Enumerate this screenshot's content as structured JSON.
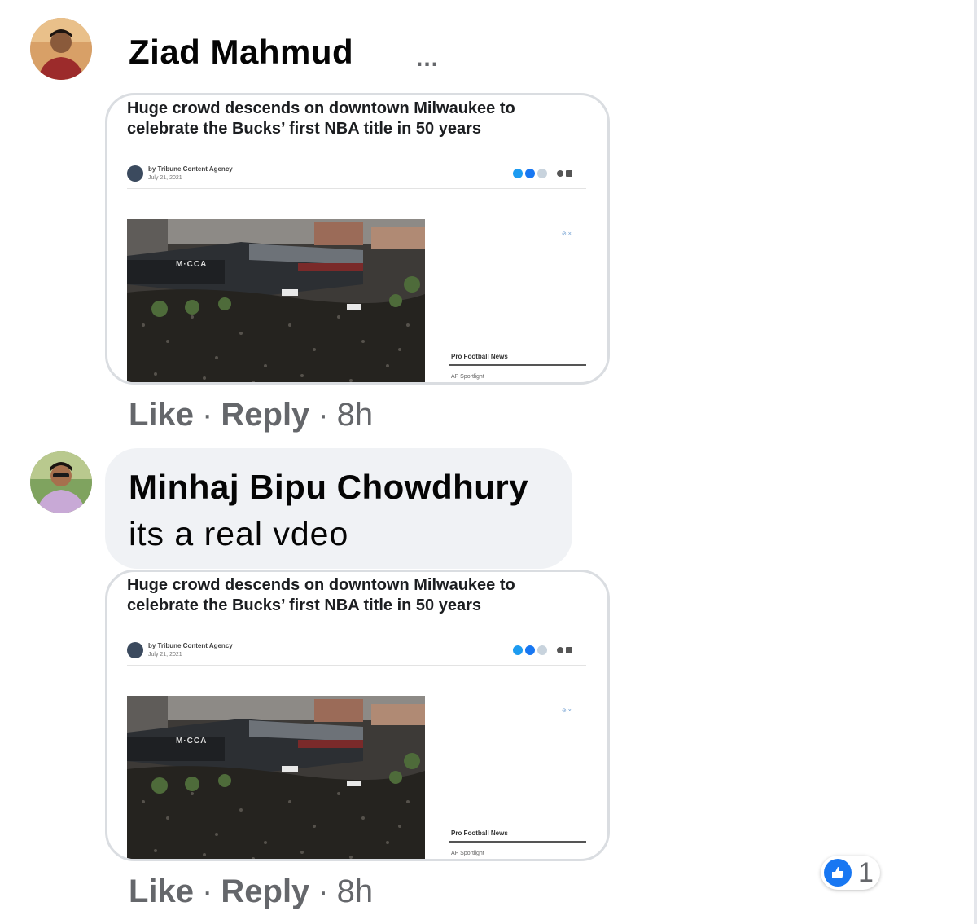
{
  "comments": [
    {
      "author": "Ziad Mahmud",
      "more_label": "...",
      "text": "",
      "link_card": {
        "headline": "Huge crowd descends on downtown Milwaukee to celebrate the Bucks’ first NBA title in 50 years",
        "byline": "by Tribune Content Agency",
        "date": "July 21, 2021",
        "ad_mark": "⊘ ×",
        "sidebar_link": "Pro Football News",
        "sidebar_sub": "AP Sportlight",
        "photo_sign": "M·CCA"
      },
      "actions": {
        "like": "Like",
        "reply": "Reply",
        "time": "8h",
        "separator": "·"
      }
    },
    {
      "author": "Minhaj Bipu Chowdhury",
      "text": "its a real vdeo",
      "link_card": {
        "headline": "Huge crowd descends on downtown Milwaukee to celebrate the Bucks’ first NBA title in 50 years",
        "byline": "by Tribune Content Agency",
        "date": "July 21, 2021",
        "ad_mark": "⊘ ×",
        "sidebar_link": "Pro Football News",
        "sidebar_sub": "AP Sportlight",
        "photo_sign": "M·CCA"
      },
      "actions": {
        "like": "Like",
        "reply": "Reply",
        "time": "8h",
        "separator": "·"
      },
      "reactions": {
        "icon": "thumbs-up-icon",
        "count": "1"
      }
    }
  ],
  "colors": {
    "accent": "#1877f2",
    "bubble": "#f0f2f5",
    "meta_text": "#65676b"
  }
}
